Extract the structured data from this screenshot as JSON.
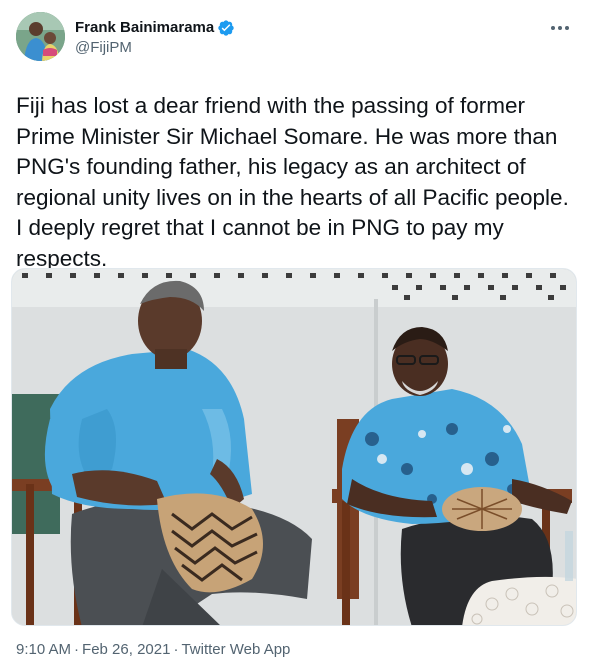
{
  "author": {
    "display_name": "Frank Bainimarama",
    "handle": "@FijiPM",
    "verified": true,
    "avatar_icon": "profile-photo",
    "verified_icon": "verified-badge-icon"
  },
  "more_icon": "more-options-icon",
  "tweet": {
    "text": "Fiji has lost a dear friend with the passing of former\nPrime Minister Sir Michael Somare. He was more than\nPNG's founding father, his legacy as an architect of\nregional unity lives on in the hearts of all Pacific people.\nI deeply regret that I cannot be in PNG to pay my\nrespects."
  },
  "media": {
    "type": "photo"
  },
  "meta": {
    "time": "9:10 AM",
    "separator": "·",
    "date": "Feb 26, 2021",
    "source": "Twitter Web App"
  },
  "colors": {
    "text_primary": "#0f1419",
    "text_secondary": "#536471",
    "verified_blue": "#1d9bf0",
    "shirt_blue": "#4aa8dc"
  }
}
